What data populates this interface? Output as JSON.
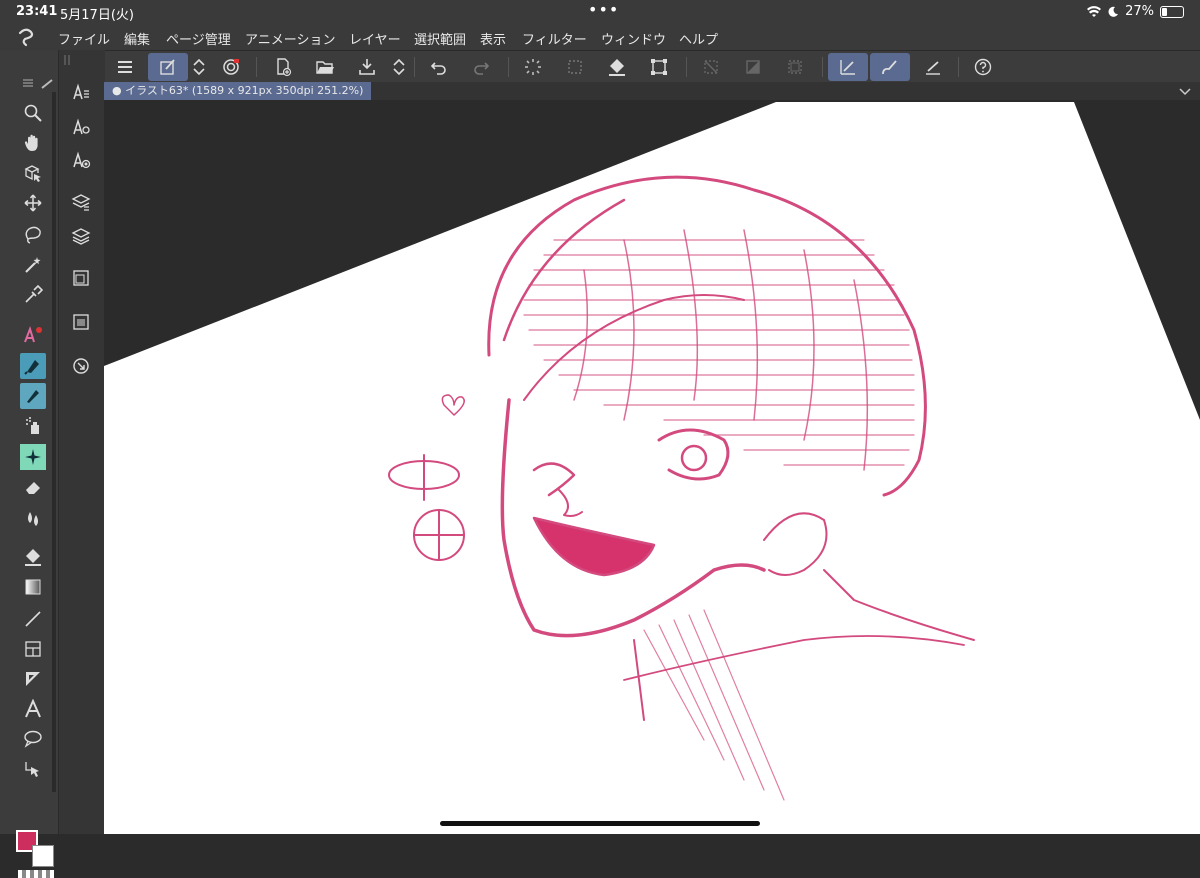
{
  "status": {
    "time": "23:41",
    "date": "5月17日(火)",
    "dots": "•••",
    "battery_percent": "27%",
    "battery_level": 0.27
  },
  "menu": {
    "items": [
      "ファイル",
      "編集",
      "ページ管理",
      "アニメーション",
      "レイヤー",
      "選択範囲",
      "表示",
      "フィルター",
      "ウィンドウ",
      "ヘルプ"
    ]
  },
  "tab": {
    "title": "● イラスト63* (1589 x 921px 350dpi 251.2%)"
  },
  "colors": {
    "main_color": "#cc2f5e",
    "sub_color": "#ffffff",
    "accent": "#5a6a90",
    "selected_tool": "#4a9cb8"
  },
  "icons": {
    "toolbar": [
      "menu-icon",
      "quick-access-icon",
      "up-down-icon",
      "spiral-icon",
      "new-file-icon",
      "open-folder-icon",
      "save-icon",
      "up-down-icon",
      "undo-icon",
      "redo-icon",
      "loading-icon",
      "select-all-icon",
      "fill-icon",
      "transform-icon",
      "deselect-icon",
      "invert-icon",
      "border-icon",
      "snap-ruler-icon",
      "snap-brush-icon",
      "snap-line-icon",
      "help-icon"
    ],
    "left_tools": [
      "zoom-icon",
      "hand-icon",
      "object-icon",
      "move-icon",
      "lasso-icon",
      "magic-wand-icon",
      "eyedropper-icon",
      "text-brush-icon",
      "pen-icon",
      "pencil-icon",
      "airbrush-icon",
      "decoration-icon",
      "eraser-icon",
      "blend-icon",
      "fill-icon",
      "gradient-icon",
      "line-icon",
      "frame-icon",
      "ruler-icon",
      "text-icon",
      "balloon-icon",
      "correction-icon"
    ]
  }
}
